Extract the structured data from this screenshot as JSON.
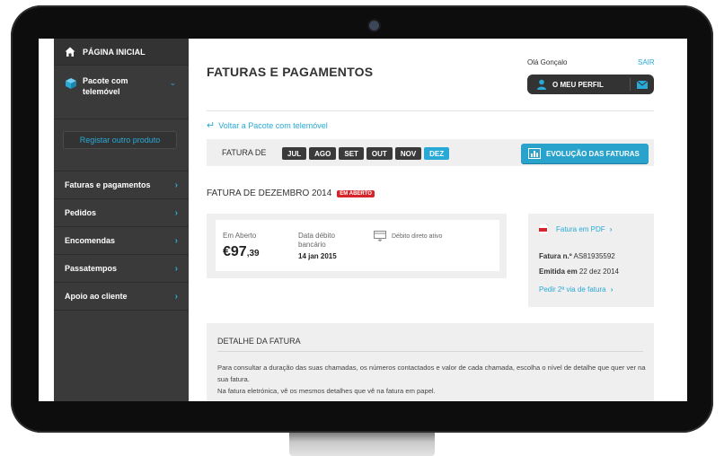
{
  "sidebar": {
    "home_label": "PÁGINA INICIAL",
    "product_label": "Pacote com telemóvel",
    "register_label": "Registar outro produto",
    "items": [
      {
        "label": "Faturas e pagamentos"
      },
      {
        "label": "Pedidos"
      },
      {
        "label": "Encomendas"
      },
      {
        "label": "Passatempos"
      },
      {
        "label": "Apoio ao cliente"
      }
    ]
  },
  "header": {
    "title": "FATURAS E PAGAMENTOS",
    "greeting": "Olá Gonçalo",
    "logout": "SAIR",
    "profile_label": "O MEU PERFIL"
  },
  "back_link": "Voltar a Pacote com telemóvel",
  "invoice_selector": {
    "label": "FATURA DE",
    "months": [
      "JUL",
      "AGO",
      "SET",
      "OUT",
      "NOV",
      "DEZ"
    ],
    "active_month": "DEZ",
    "evolution_button": "EVOLUÇÃO DAS FATURAS"
  },
  "invoice": {
    "title": "FATURA DE DEZEMBRO 2014",
    "status_badge": "EM ABERTO",
    "open_label": "Em Aberto",
    "amount_main": "€97",
    "amount_cents": ",39",
    "debit_date_label": "Data débito bancário",
    "debit_date": "14 jan 2015",
    "direct_debit": "Débito direto ativo"
  },
  "pdf_panel": {
    "pdf_link": "Fatura em PDF",
    "number_label": "Fatura n.º",
    "number_value": "AS81935592",
    "issued_label": "Emitida em",
    "issued_value": "22 dez 2014",
    "second_copy": "Pedir 2ª via de fatura"
  },
  "detail": {
    "title": "DETALHE DA FATURA",
    "text1": "Para consultar a duração das suas chamadas, os números contactados e valor de cada chamada, escolha o nível de detalhe que quer ver na sua fatura.",
    "text2": "Na fatura eletrónica, vê os mesmos detalhes que vê na fatura em papel."
  },
  "colors": {
    "accent": "#29a9d6",
    "sidebar": "#3a3a3a",
    "badge": "#d7232a"
  }
}
